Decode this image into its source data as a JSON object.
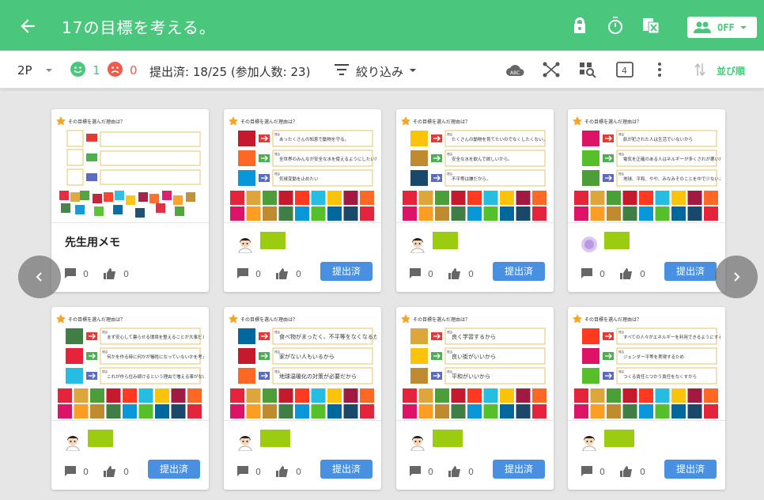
{
  "header": {
    "title": "17の目標を考える。",
    "toggle_label": "OFF"
  },
  "toolbar": {
    "page_selector": "2P",
    "happy_count": "1",
    "sad_count": "0",
    "submission_status": "提出済: 18/25 (参加人数: 23)",
    "filter_label": "絞り込み",
    "sort_label": "並び順"
  },
  "cards": [
    {
      "title": "先生用メモ",
      "comments": "0",
      "likes": "0",
      "submit_label": ""
    },
    {
      "comments": "0",
      "likes": "0",
      "submit_label": "提出済"
    },
    {
      "comments": "0",
      "likes": "0",
      "submit_label": "提出済"
    },
    {
      "comments": "0",
      "likes": "0",
      "submit_label": "提出済"
    },
    {
      "comments": "0",
      "likes": "0",
      "submit_label": "提出済"
    },
    {
      "comments": "0",
      "likes": "0",
      "submit_label": "提出済"
    },
    {
      "comments": "0",
      "likes": "0",
      "submit_label": "提出済"
    },
    {
      "comments": "0",
      "likes": "0",
      "submit_label": "提出済"
    }
  ],
  "worksheet": {
    "question": "その目標を選んだ理由は？",
    "reason_label": "理由"
  },
  "handwritten": {
    "c2": [
      "あったくさんの知恵で動物を守る。",
      "全世界のみんなが安全な水を使えるようにしたいから。",
      "気候変動を止めたい"
    ],
    "c3": [
      "たくさんの動物を育てたいのでなくしたくない。",
      "安全な水を飲んで欲しいから。",
      "不平等は嫌だから。"
    ],
    "c4": [
      "飢が犯された人は生活でいないから",
      "電気を正確のある人はネルギーが多くされが悪いから",
      "地球、平和、やや、みなみそのことを中で少ないことでからいるもう守ろうといいから"
    ],
    "c5": [
      "まず安心して暮らせる環境を整えることが大事だと思うから。",
      "何かを作る時に何かが犠牲になっていないかを考えることが必要だと思ったから。",
      "これが作ら住み続けるという理由で増える事がない街作りにしたいから。"
    ],
    "c6": [
      "食べ物がまったく、不平等をなくなるから",
      "家がない人もいるから",
      "地球温暖化の対策が必要だから"
    ],
    "c7": [
      "良く学習するから",
      "良い街がいいから",
      "平和がいいから"
    ],
    "c8": [
      "すべての人々がエネルギーを利用できるようにするから",
      "ジェンダー平等を実現するため",
      "つくる責任とつかう責任をなくすから"
    ]
  },
  "colors": {
    "header": "#4ac77d",
    "submit": "#4a90e2",
    "name_mask": "#9ccc0f"
  }
}
